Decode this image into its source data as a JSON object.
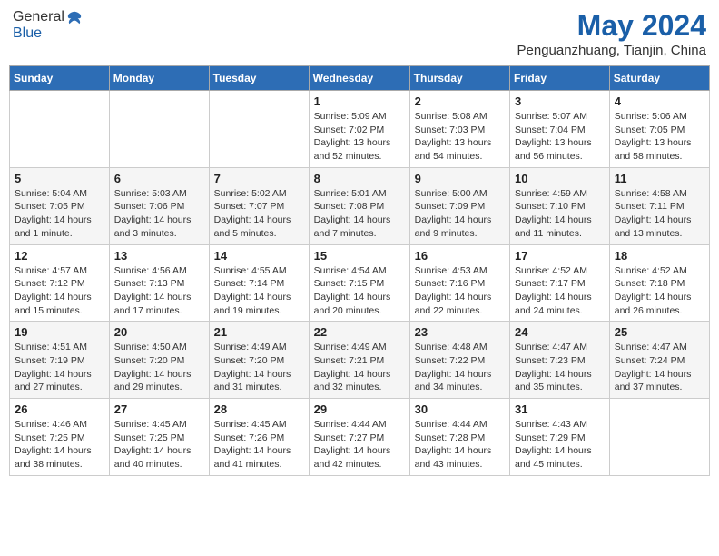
{
  "header": {
    "logo_line1": "General",
    "logo_line2": "Blue",
    "month_title": "May 2024",
    "location": "Penguanzhuang, Tianjin, China"
  },
  "days_of_week": [
    "Sunday",
    "Monday",
    "Tuesday",
    "Wednesday",
    "Thursday",
    "Friday",
    "Saturday"
  ],
  "weeks": [
    [
      {
        "day": "",
        "info": ""
      },
      {
        "day": "",
        "info": ""
      },
      {
        "day": "",
        "info": ""
      },
      {
        "day": "1",
        "info": "Sunrise: 5:09 AM\nSunset: 7:02 PM\nDaylight: 13 hours\nand 52 minutes."
      },
      {
        "day": "2",
        "info": "Sunrise: 5:08 AM\nSunset: 7:03 PM\nDaylight: 13 hours\nand 54 minutes."
      },
      {
        "day": "3",
        "info": "Sunrise: 5:07 AM\nSunset: 7:04 PM\nDaylight: 13 hours\nand 56 minutes."
      },
      {
        "day": "4",
        "info": "Sunrise: 5:06 AM\nSunset: 7:05 PM\nDaylight: 13 hours\nand 58 minutes."
      }
    ],
    [
      {
        "day": "5",
        "info": "Sunrise: 5:04 AM\nSunset: 7:05 PM\nDaylight: 14 hours\nand 1 minute."
      },
      {
        "day": "6",
        "info": "Sunrise: 5:03 AM\nSunset: 7:06 PM\nDaylight: 14 hours\nand 3 minutes."
      },
      {
        "day": "7",
        "info": "Sunrise: 5:02 AM\nSunset: 7:07 PM\nDaylight: 14 hours\nand 5 minutes."
      },
      {
        "day": "8",
        "info": "Sunrise: 5:01 AM\nSunset: 7:08 PM\nDaylight: 14 hours\nand 7 minutes."
      },
      {
        "day": "9",
        "info": "Sunrise: 5:00 AM\nSunset: 7:09 PM\nDaylight: 14 hours\nand 9 minutes."
      },
      {
        "day": "10",
        "info": "Sunrise: 4:59 AM\nSunset: 7:10 PM\nDaylight: 14 hours\nand 11 minutes."
      },
      {
        "day": "11",
        "info": "Sunrise: 4:58 AM\nSunset: 7:11 PM\nDaylight: 14 hours\nand 13 minutes."
      }
    ],
    [
      {
        "day": "12",
        "info": "Sunrise: 4:57 AM\nSunset: 7:12 PM\nDaylight: 14 hours\nand 15 minutes."
      },
      {
        "day": "13",
        "info": "Sunrise: 4:56 AM\nSunset: 7:13 PM\nDaylight: 14 hours\nand 17 minutes."
      },
      {
        "day": "14",
        "info": "Sunrise: 4:55 AM\nSunset: 7:14 PM\nDaylight: 14 hours\nand 19 minutes."
      },
      {
        "day": "15",
        "info": "Sunrise: 4:54 AM\nSunset: 7:15 PM\nDaylight: 14 hours\nand 20 minutes."
      },
      {
        "day": "16",
        "info": "Sunrise: 4:53 AM\nSunset: 7:16 PM\nDaylight: 14 hours\nand 22 minutes."
      },
      {
        "day": "17",
        "info": "Sunrise: 4:52 AM\nSunset: 7:17 PM\nDaylight: 14 hours\nand 24 minutes."
      },
      {
        "day": "18",
        "info": "Sunrise: 4:52 AM\nSunset: 7:18 PM\nDaylight: 14 hours\nand 26 minutes."
      }
    ],
    [
      {
        "day": "19",
        "info": "Sunrise: 4:51 AM\nSunset: 7:19 PM\nDaylight: 14 hours\nand 27 minutes."
      },
      {
        "day": "20",
        "info": "Sunrise: 4:50 AM\nSunset: 7:20 PM\nDaylight: 14 hours\nand 29 minutes."
      },
      {
        "day": "21",
        "info": "Sunrise: 4:49 AM\nSunset: 7:20 PM\nDaylight: 14 hours\nand 31 minutes."
      },
      {
        "day": "22",
        "info": "Sunrise: 4:49 AM\nSunset: 7:21 PM\nDaylight: 14 hours\nand 32 minutes."
      },
      {
        "day": "23",
        "info": "Sunrise: 4:48 AM\nSunset: 7:22 PM\nDaylight: 14 hours\nand 34 minutes."
      },
      {
        "day": "24",
        "info": "Sunrise: 4:47 AM\nSunset: 7:23 PM\nDaylight: 14 hours\nand 35 minutes."
      },
      {
        "day": "25",
        "info": "Sunrise: 4:47 AM\nSunset: 7:24 PM\nDaylight: 14 hours\nand 37 minutes."
      }
    ],
    [
      {
        "day": "26",
        "info": "Sunrise: 4:46 AM\nSunset: 7:25 PM\nDaylight: 14 hours\nand 38 minutes."
      },
      {
        "day": "27",
        "info": "Sunrise: 4:45 AM\nSunset: 7:25 PM\nDaylight: 14 hours\nand 40 minutes."
      },
      {
        "day": "28",
        "info": "Sunrise: 4:45 AM\nSunset: 7:26 PM\nDaylight: 14 hours\nand 41 minutes."
      },
      {
        "day": "29",
        "info": "Sunrise: 4:44 AM\nSunset: 7:27 PM\nDaylight: 14 hours\nand 42 minutes."
      },
      {
        "day": "30",
        "info": "Sunrise: 4:44 AM\nSunset: 7:28 PM\nDaylight: 14 hours\nand 43 minutes."
      },
      {
        "day": "31",
        "info": "Sunrise: 4:43 AM\nSunset: 7:29 PM\nDaylight: 14 hours\nand 45 minutes."
      },
      {
        "day": "",
        "info": ""
      }
    ]
  ],
  "colors": {
    "header_bg": "#2d6db5",
    "logo_blue": "#1a5fa8"
  }
}
